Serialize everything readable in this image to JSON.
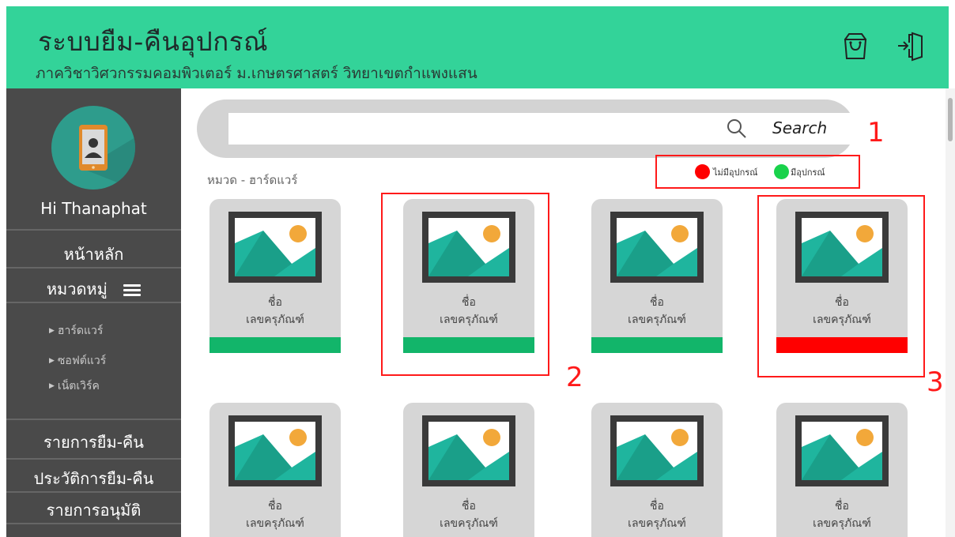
{
  "header": {
    "title": "ระบบยืม-คืนอุปกรณ์",
    "subtitle": "ภาควิชาวิศวกรรมคอมพิวเตอร์ ม.เกษตรศาสตร์ วิทยาเขตกำแพงแสน",
    "icons": [
      "shopping-bag-icon",
      "logout-icon"
    ]
  },
  "sidebar": {
    "greeting": "Hi Thanaphat",
    "home": "หน้าหลัก",
    "categories": "หมวดหมู่",
    "sub_items": [
      {
        "label": "ฮาร์ดแวร์"
      },
      {
        "label": "ซอฟต์แวร์"
      },
      {
        "label": "เน็ตเวิร์ค"
      }
    ],
    "borrow_list": "รายการยืม-คืน",
    "borrow_history": "ประวัติการยืม-คืน",
    "approval_list": "รายการอนุมัติ"
  },
  "search": {
    "placeholder": "",
    "button_label": "Search"
  },
  "legend": {
    "unavailable": "ไม่มีอุปกรณ์",
    "available": "มีอุปกรณ์",
    "unavailable_color": "#ff0000",
    "available_color": "#19d24b"
  },
  "breadcrumb": "หมวด - ฮาร์ดแวร์",
  "cards": [
    {
      "name": "ชื่อ",
      "serial": "เลขครุภัณฑ์",
      "status": "available"
    },
    {
      "name": "ชื่อ",
      "serial": "เลขครุภัณฑ์",
      "status": "available"
    },
    {
      "name": "ชื่อ",
      "serial": "เลขครุภัณฑ์",
      "status": "available"
    },
    {
      "name": "ชื่อ",
      "serial": "เลขครุภัณฑ์",
      "status": "unavailable"
    },
    {
      "name": "ชื่อ",
      "serial": "เลขครุภัณฑ์",
      "status": ""
    },
    {
      "name": "ชื่อ",
      "serial": "เลขครุภัณฑ์",
      "status": ""
    },
    {
      "name": "ชื่อ",
      "serial": "เลขครุภัณฑ์",
      "status": ""
    },
    {
      "name": "ชื่อ",
      "serial": "เลขครุภัณฑ์",
      "status": ""
    }
  ],
  "colors": {
    "header_bg": "#33d399",
    "sidebar_bg": "#4a4a4a",
    "available_bar": "#12b56a",
    "unavailable_bar": "#ff0000",
    "annotation": "#ff1a1a"
  },
  "annotations": [
    "1",
    "2",
    "3"
  ]
}
